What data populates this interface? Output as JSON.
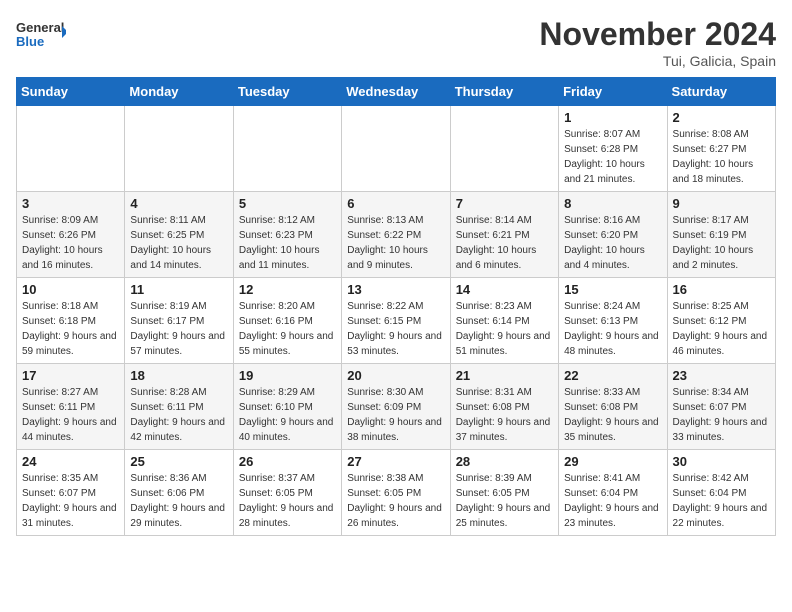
{
  "logo": {
    "text_general": "General",
    "text_blue": "Blue"
  },
  "title": "November 2024",
  "location": "Tui, Galicia, Spain",
  "weekdays": [
    "Sunday",
    "Monday",
    "Tuesday",
    "Wednesday",
    "Thursday",
    "Friday",
    "Saturday"
  ],
  "weeks": [
    [
      {
        "day": "",
        "sunrise": "",
        "sunset": "",
        "daylight": ""
      },
      {
        "day": "",
        "sunrise": "",
        "sunset": "",
        "daylight": ""
      },
      {
        "day": "",
        "sunrise": "",
        "sunset": "",
        "daylight": ""
      },
      {
        "day": "",
        "sunrise": "",
        "sunset": "",
        "daylight": ""
      },
      {
        "day": "",
        "sunrise": "",
        "sunset": "",
        "daylight": ""
      },
      {
        "day": "1",
        "sunrise": "Sunrise: 8:07 AM",
        "sunset": "Sunset: 6:28 PM",
        "daylight": "Daylight: 10 hours and 21 minutes."
      },
      {
        "day": "2",
        "sunrise": "Sunrise: 8:08 AM",
        "sunset": "Sunset: 6:27 PM",
        "daylight": "Daylight: 10 hours and 18 minutes."
      }
    ],
    [
      {
        "day": "3",
        "sunrise": "Sunrise: 8:09 AM",
        "sunset": "Sunset: 6:26 PM",
        "daylight": "Daylight: 10 hours and 16 minutes."
      },
      {
        "day": "4",
        "sunrise": "Sunrise: 8:11 AM",
        "sunset": "Sunset: 6:25 PM",
        "daylight": "Daylight: 10 hours and 14 minutes."
      },
      {
        "day": "5",
        "sunrise": "Sunrise: 8:12 AM",
        "sunset": "Sunset: 6:23 PM",
        "daylight": "Daylight: 10 hours and 11 minutes."
      },
      {
        "day": "6",
        "sunrise": "Sunrise: 8:13 AM",
        "sunset": "Sunset: 6:22 PM",
        "daylight": "Daylight: 10 hours and 9 minutes."
      },
      {
        "day": "7",
        "sunrise": "Sunrise: 8:14 AM",
        "sunset": "Sunset: 6:21 PM",
        "daylight": "Daylight: 10 hours and 6 minutes."
      },
      {
        "day": "8",
        "sunrise": "Sunrise: 8:16 AM",
        "sunset": "Sunset: 6:20 PM",
        "daylight": "Daylight: 10 hours and 4 minutes."
      },
      {
        "day": "9",
        "sunrise": "Sunrise: 8:17 AM",
        "sunset": "Sunset: 6:19 PM",
        "daylight": "Daylight: 10 hours and 2 minutes."
      }
    ],
    [
      {
        "day": "10",
        "sunrise": "Sunrise: 8:18 AM",
        "sunset": "Sunset: 6:18 PM",
        "daylight": "Daylight: 9 hours and 59 minutes."
      },
      {
        "day": "11",
        "sunrise": "Sunrise: 8:19 AM",
        "sunset": "Sunset: 6:17 PM",
        "daylight": "Daylight: 9 hours and 57 minutes."
      },
      {
        "day": "12",
        "sunrise": "Sunrise: 8:20 AM",
        "sunset": "Sunset: 6:16 PM",
        "daylight": "Daylight: 9 hours and 55 minutes."
      },
      {
        "day": "13",
        "sunrise": "Sunrise: 8:22 AM",
        "sunset": "Sunset: 6:15 PM",
        "daylight": "Daylight: 9 hours and 53 minutes."
      },
      {
        "day": "14",
        "sunrise": "Sunrise: 8:23 AM",
        "sunset": "Sunset: 6:14 PM",
        "daylight": "Daylight: 9 hours and 51 minutes."
      },
      {
        "day": "15",
        "sunrise": "Sunrise: 8:24 AM",
        "sunset": "Sunset: 6:13 PM",
        "daylight": "Daylight: 9 hours and 48 minutes."
      },
      {
        "day": "16",
        "sunrise": "Sunrise: 8:25 AM",
        "sunset": "Sunset: 6:12 PM",
        "daylight": "Daylight: 9 hours and 46 minutes."
      }
    ],
    [
      {
        "day": "17",
        "sunrise": "Sunrise: 8:27 AM",
        "sunset": "Sunset: 6:11 PM",
        "daylight": "Daylight: 9 hours and 44 minutes."
      },
      {
        "day": "18",
        "sunrise": "Sunrise: 8:28 AM",
        "sunset": "Sunset: 6:11 PM",
        "daylight": "Daylight: 9 hours and 42 minutes."
      },
      {
        "day": "19",
        "sunrise": "Sunrise: 8:29 AM",
        "sunset": "Sunset: 6:10 PM",
        "daylight": "Daylight: 9 hours and 40 minutes."
      },
      {
        "day": "20",
        "sunrise": "Sunrise: 8:30 AM",
        "sunset": "Sunset: 6:09 PM",
        "daylight": "Daylight: 9 hours and 38 minutes."
      },
      {
        "day": "21",
        "sunrise": "Sunrise: 8:31 AM",
        "sunset": "Sunset: 6:08 PM",
        "daylight": "Daylight: 9 hours and 37 minutes."
      },
      {
        "day": "22",
        "sunrise": "Sunrise: 8:33 AM",
        "sunset": "Sunset: 6:08 PM",
        "daylight": "Daylight: 9 hours and 35 minutes."
      },
      {
        "day": "23",
        "sunrise": "Sunrise: 8:34 AM",
        "sunset": "Sunset: 6:07 PM",
        "daylight": "Daylight: 9 hours and 33 minutes."
      }
    ],
    [
      {
        "day": "24",
        "sunrise": "Sunrise: 8:35 AM",
        "sunset": "Sunset: 6:07 PM",
        "daylight": "Daylight: 9 hours and 31 minutes."
      },
      {
        "day": "25",
        "sunrise": "Sunrise: 8:36 AM",
        "sunset": "Sunset: 6:06 PM",
        "daylight": "Daylight: 9 hours and 29 minutes."
      },
      {
        "day": "26",
        "sunrise": "Sunrise: 8:37 AM",
        "sunset": "Sunset: 6:05 PM",
        "daylight": "Daylight: 9 hours and 28 minutes."
      },
      {
        "day": "27",
        "sunrise": "Sunrise: 8:38 AM",
        "sunset": "Sunset: 6:05 PM",
        "daylight": "Daylight: 9 hours and 26 minutes."
      },
      {
        "day": "28",
        "sunrise": "Sunrise: 8:39 AM",
        "sunset": "Sunset: 6:05 PM",
        "daylight": "Daylight: 9 hours and 25 minutes."
      },
      {
        "day": "29",
        "sunrise": "Sunrise: 8:41 AM",
        "sunset": "Sunset: 6:04 PM",
        "daylight": "Daylight: 9 hours and 23 minutes."
      },
      {
        "day": "30",
        "sunrise": "Sunrise: 8:42 AM",
        "sunset": "Sunset: 6:04 PM",
        "daylight": "Daylight: 9 hours and 22 minutes."
      }
    ]
  ]
}
